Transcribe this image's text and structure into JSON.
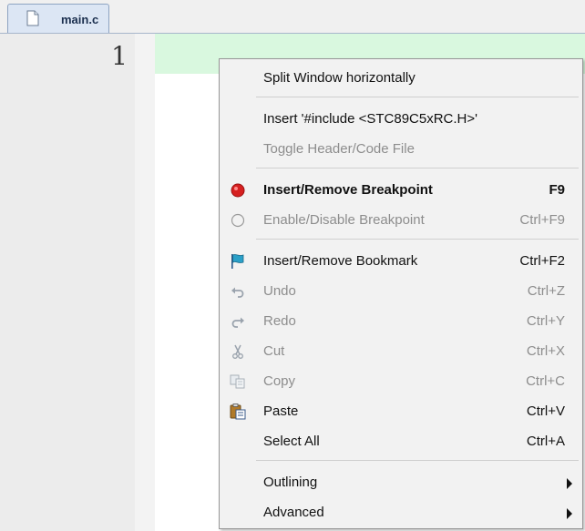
{
  "tab": {
    "label": "main.c"
  },
  "editor": {
    "line_number": "1"
  },
  "menu": {
    "split_window": {
      "label": "Split Window horizontally"
    },
    "insert_include": {
      "label": "Insert '#include <STC89C5xRC.H>'"
    },
    "toggle_header": {
      "label": "Toggle Header/Code File"
    },
    "insert_breakpoint": {
      "label": "Insert/Remove Breakpoint",
      "shortcut": "F9"
    },
    "enable_breakpoint": {
      "label": "Enable/Disable Breakpoint",
      "shortcut": "Ctrl+F9"
    },
    "insert_bookmark": {
      "label": "Insert/Remove Bookmark",
      "shortcut": "Ctrl+F2"
    },
    "undo": {
      "label": "Undo",
      "shortcut": "Ctrl+Z"
    },
    "redo": {
      "label": "Redo",
      "shortcut": "Ctrl+Y"
    },
    "cut": {
      "label": "Cut",
      "shortcut": "Ctrl+X"
    },
    "copy": {
      "label": "Copy",
      "shortcut": "Ctrl+C"
    },
    "paste": {
      "label": "Paste",
      "shortcut": "Ctrl+V"
    },
    "select_all": {
      "label": "Select All",
      "shortcut": "Ctrl+A"
    },
    "outlining": {
      "label": "Outlining"
    },
    "advanced": {
      "label": "Advanced"
    }
  },
  "colors": {
    "current_line": "#d9f8df",
    "breakpoint": "#d62020",
    "menu_background": "#f2f2f2"
  }
}
